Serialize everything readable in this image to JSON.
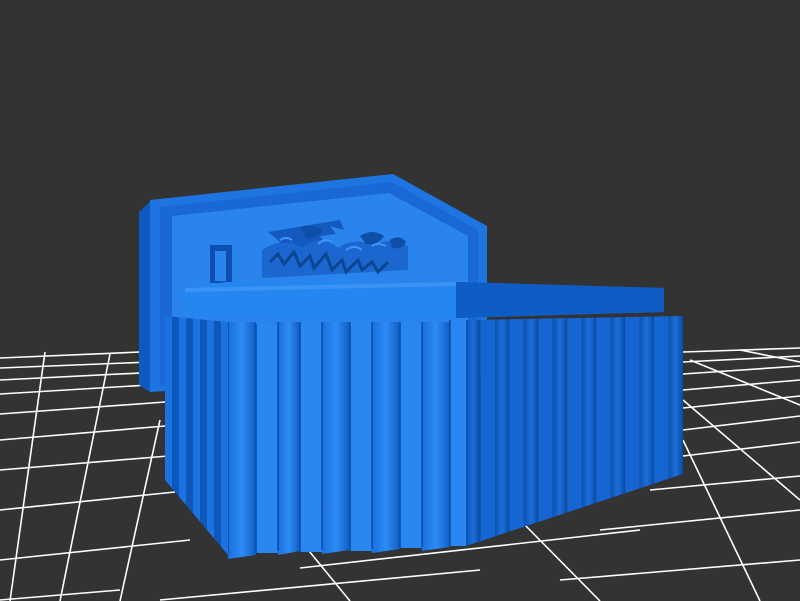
{
  "scene": {
    "background_color": "#333333",
    "grid_color": "#ffffff",
    "model_color": "#1f78e8",
    "model_highlight": "#3a8ff2",
    "model_shadow": "#0d56b8"
  }
}
